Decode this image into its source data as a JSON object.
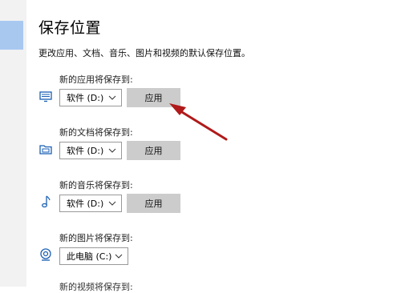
{
  "header": {
    "title": "保存位置",
    "description": "更改应用、文档、音乐、图片和视频的默认保存位置。"
  },
  "sections": [
    {
      "label": "新的应用将保存到:",
      "icon": "monitor-icon",
      "selected": "软件 (D:)",
      "apply_label": "应用"
    },
    {
      "label": "新的文档将保存到:",
      "icon": "folder-icon",
      "selected": "软件 (D:)",
      "apply_label": "应用"
    },
    {
      "label": "新的音乐将保存到:",
      "icon": "music-note-icon",
      "selected": "软件 (D:)",
      "apply_label": "应用"
    },
    {
      "label": "新的图片将保存到:",
      "icon": "camera-icon",
      "selected": "此电脑 (C:)"
    }
  ],
  "partial_label": "新的视频将保存到:",
  "colors": {
    "accent": "#a8c8f0",
    "annotation_arrow": "#b01a1a",
    "button_bg": "#cccccc",
    "icon_blue": "#1a5fb4"
  }
}
